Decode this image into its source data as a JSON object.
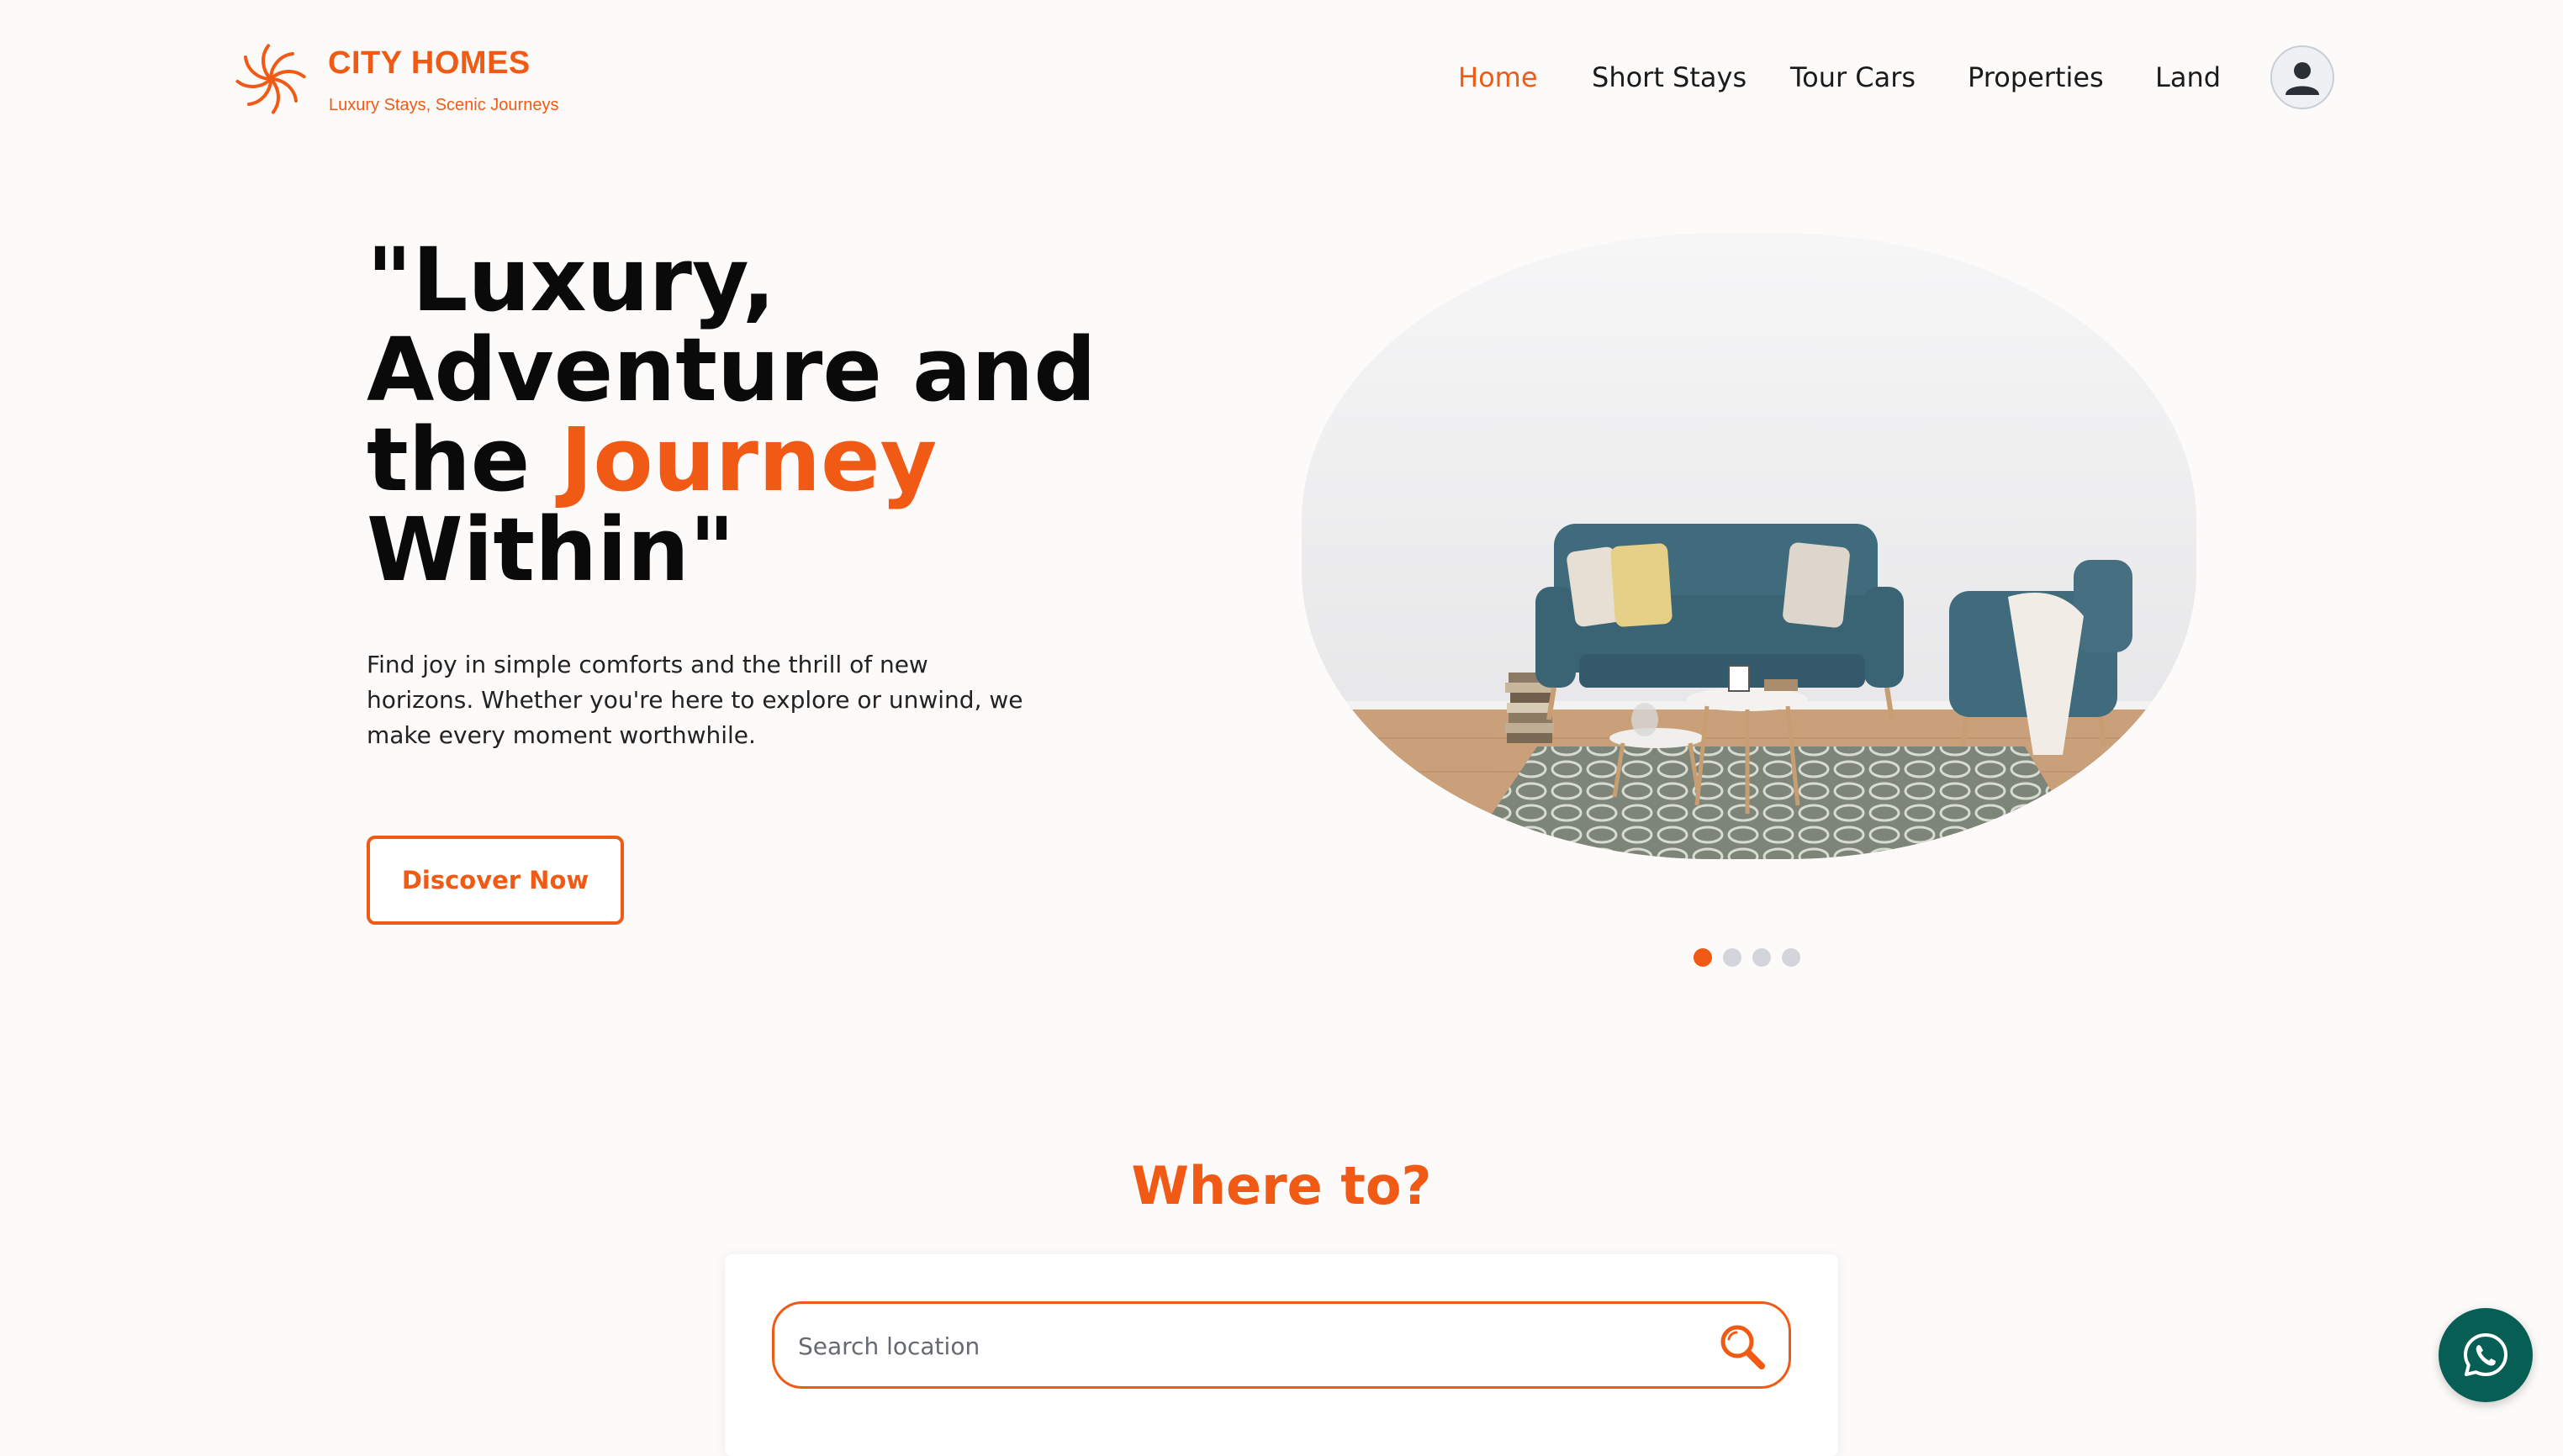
{
  "brand": {
    "name": "CITY HOMES",
    "tagline": "Luxury Stays, Scenic Journeys",
    "logo_icon": "swirl-logo-icon",
    "accent_color": "#f15a14"
  },
  "nav": {
    "items": [
      {
        "label": "Home",
        "active": true
      },
      {
        "label": "Short Stays",
        "active": false
      },
      {
        "label": "Tour Cars",
        "active": false
      },
      {
        "label": "Properties",
        "active": false
      },
      {
        "label": "Land",
        "active": false
      }
    ],
    "account_icon": "user-avatar-icon"
  },
  "hero": {
    "title_line1": "\"Luxury,",
    "title_line2": "Adventure and",
    "title_line3_prefix": "the ",
    "title_line3_accent": "Journey",
    "title_line4": "Within\"",
    "description": "Find joy in simple comforts and the thrill of new horizons. Whether you're here to explore or unwind, we make every moment worthwhile.",
    "cta_label": "Discover Now",
    "image_subject": "living-room-sofa-photo",
    "carousel": {
      "slide_count": 4,
      "active_index": 0
    }
  },
  "search_section": {
    "title": "Where to?",
    "placeholder": "Search location",
    "value": "",
    "icon": "search-icon"
  },
  "floating": {
    "whatsapp_icon": "whatsapp-icon",
    "whatsapp_color": "#075e54"
  }
}
